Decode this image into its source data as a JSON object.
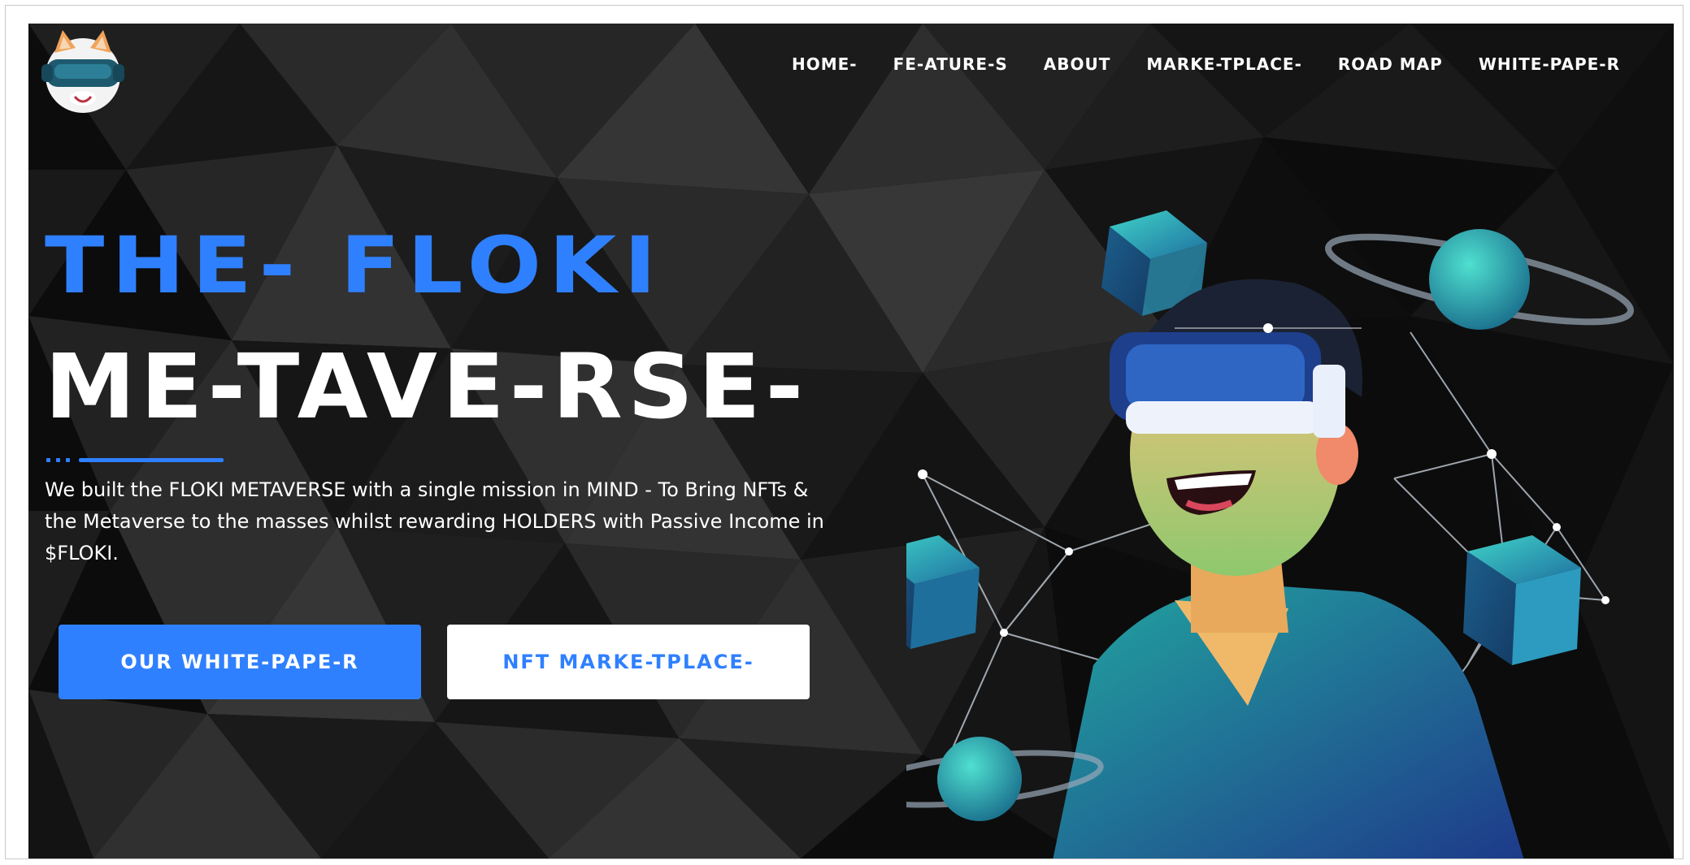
{
  "nav": {
    "items": [
      {
        "label": "HOME-",
        "id": "home"
      },
      {
        "label": "FE-ATURE-S",
        "id": "features"
      },
      {
        "label": "ABOUT",
        "id": "about"
      },
      {
        "label": "MARKE-TPLACE-",
        "id": "marketplace"
      },
      {
        "label": "ROAD MAP",
        "id": "roadmap"
      },
      {
        "label": "WHITE-PAPE-R",
        "id": "whitepaper"
      }
    ]
  },
  "hero": {
    "title_line1": "THE- FLOKI",
    "title_line2": "ME-TAVE-RSE-",
    "description": "We built the FLOKI METAVERSE with a single mission in MIND - To Bring NFTs & the Metaverse to the masses whilst rewarding HOLDERS with Passive Income in $FLOKI.",
    "primary_button": "OUR WHITE-PAPE-R",
    "secondary_button": "NFT MARKE-TPLACE-"
  },
  "colors": {
    "accent": "#2f80ff",
    "background": "#0b0b0b",
    "text": "#ffffff"
  },
  "icons": {
    "logo": "floki-shiba-vr-logo",
    "illustration": "vr-headset-person-illustration"
  }
}
